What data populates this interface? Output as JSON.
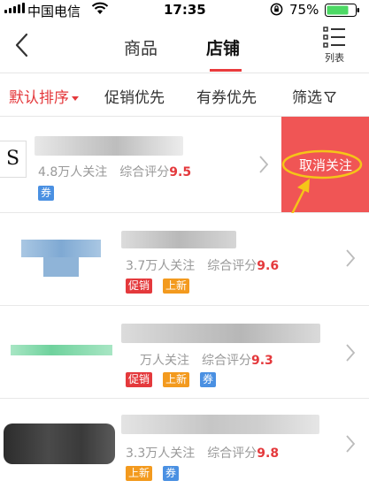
{
  "status_bar": {
    "carrier": "中国电信",
    "time": "17:35",
    "battery_percent": "75%"
  },
  "nav": {
    "tab_goods": "商品",
    "tab_shop": "店铺",
    "list_label": "列表"
  },
  "filters": {
    "default_sort": "默认排序",
    "promo_first": "促销优先",
    "coupon_first": "有券优先",
    "screen": "筛选"
  },
  "shops": [
    {
      "logo_text": "S",
      "followers": "4.8万人关注",
      "score_label": "综合评分",
      "score": "9.5",
      "badges": [
        "券"
      ]
    },
    {
      "followers": "3.7万人关注",
      "score_label": "综合评分",
      "score": "9.6",
      "badges": [
        "促销",
        "上新"
      ]
    },
    {
      "followers": "万人关注",
      "score_label": "综合评分",
      "score": "9.3",
      "badges": [
        "促销",
        "上新",
        "券"
      ]
    },
    {
      "followers": "3.3万人关注",
      "score_label": "综合评分",
      "score": "9.8",
      "badges": [
        "上新",
        "券"
      ]
    }
  ],
  "unfollow_label": "取消关注",
  "colors": {
    "accent": "#e4393c",
    "unfollow_bg": "#f05555",
    "annotation": "#f5c518",
    "badge_promo": "#e4393c",
    "badge_new": "#f39a1e",
    "badge_coupon": "#4a90e2"
  }
}
